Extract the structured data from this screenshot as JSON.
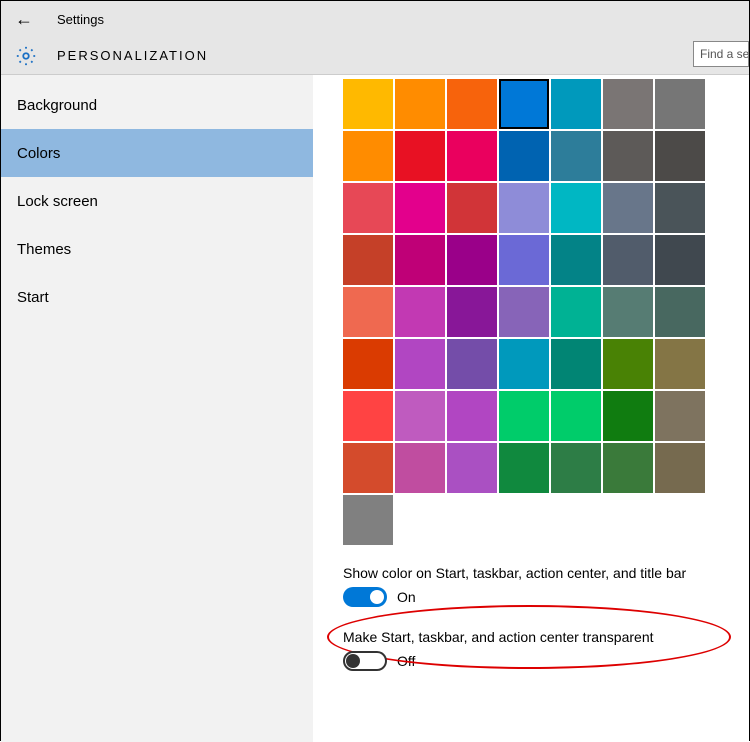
{
  "topbar": {
    "title": "Settings"
  },
  "category": {
    "title": "PERSONALIZATION"
  },
  "search": {
    "placeholder": "Find a set"
  },
  "sidebar": {
    "items": [
      {
        "label": "Background",
        "selected": false
      },
      {
        "label": "Colors",
        "selected": true
      },
      {
        "label": "Lock screen",
        "selected": false
      },
      {
        "label": "Themes",
        "selected": false
      },
      {
        "label": "Start",
        "selected": false
      }
    ]
  },
  "color_grid": {
    "selected_index": 3,
    "rows": [
      [
        "#ffb900",
        "#ff8c00",
        "#f7630c",
        "#0078d7",
        "#0099bc",
        "#7a7574",
        "#767676"
      ],
      [
        "#ff8c00",
        "#e81123",
        "#ea005e",
        "#0063b1",
        "#2d7d9a",
        "#5d5a58",
        "#4c4a48"
      ],
      [
        "#e74856",
        "#e3008c",
        "#d13438",
        "#8e8cd8",
        "#00b7c3",
        "#68768a",
        "#4a5459"
      ],
      [
        "#c54028",
        "#bf0077",
        "#9a0089",
        "#6b69d6",
        "#038387",
        "#515c6b",
        "#40484f"
      ],
      [
        "#ef6950",
        "#c239b3",
        "#881798",
        "#8764b8",
        "#00b294",
        "#567c73",
        "#486860"
      ],
      [
        "#da3b01",
        "#b146c2",
        "#744da9",
        "#0099bc",
        "#018574",
        "#498205",
        "#847545"
      ],
      [
        "#ff4343",
        "#bf5bbf",
        "#b146c2",
        "#00cc6a",
        "#00cc6a",
        "#107c10",
        "#7e735f"
      ],
      [
        "#d44b2c",
        "#c04da0",
        "#aa50c2",
        "#10893e",
        "#2d7d46",
        "#3a7a3a",
        "#766a4f"
      ]
    ],
    "extra": "#808080"
  },
  "settings": {
    "show_color": {
      "label": "Show color on Start, taskbar, action center, and title bar",
      "state_label": "On",
      "on": true
    },
    "transparency": {
      "label": "Make Start, taskbar, and action center transparent",
      "state_label": "Off",
      "on": false
    }
  }
}
